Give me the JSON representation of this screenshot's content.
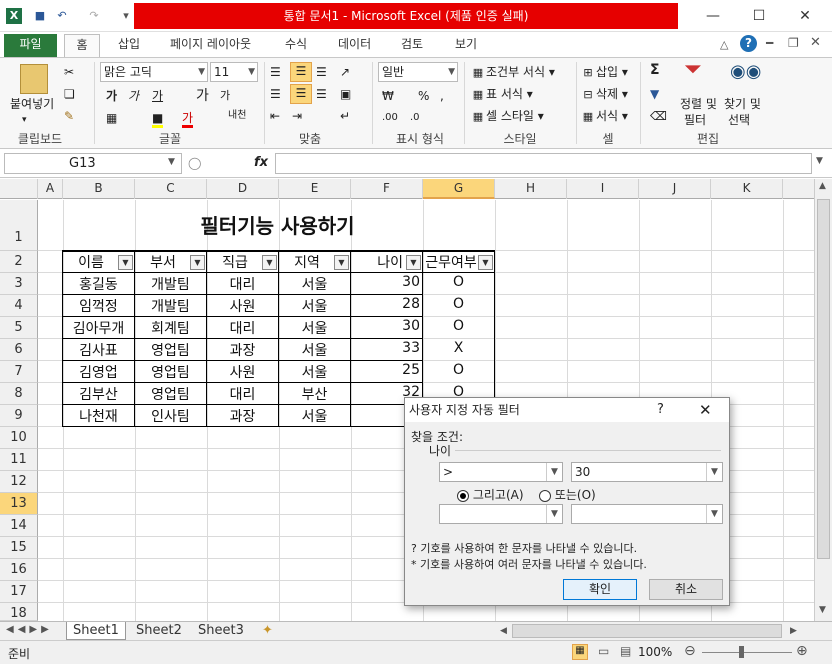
{
  "window": {
    "title": "통합 문서1 - Microsoft Excel (제품 인증 실패)"
  },
  "ribbon_tabs": [
    "파일",
    "홈",
    "삽입",
    "페이지 레이아웃",
    "수식",
    "데이터",
    "검토",
    "보기"
  ],
  "ribbon": {
    "paste_label": "붙여넣기",
    "font_name": "맑은 고딕",
    "font_size": "11",
    "number_format": "일반",
    "conditional_format": "조건부 서식",
    "table_format": "표 서식",
    "cell_style": "셀 스타일",
    "insert": "삽입",
    "delete": "삭제",
    "format": "서식",
    "sort_filter": "정렬 및",
    "sort_filter2": "필터",
    "find_select": "찾기 및",
    "find_select2": "선택",
    "groups": [
      "클립보드",
      "글꼴",
      "맞춤",
      "표시 형식",
      "스타일",
      "셀",
      "편집"
    ]
  },
  "formula_bar": {
    "name_box": "G13",
    "fx": "fx",
    "formula": ""
  },
  "columns": [
    "A",
    "B",
    "C",
    "D",
    "E",
    "F",
    "G",
    "H",
    "I",
    "J",
    "K"
  ],
  "rows": [
    "1",
    "2",
    "3",
    "4",
    "5",
    "6",
    "7",
    "8",
    "9",
    "10",
    "11",
    "12",
    "13",
    "14",
    "15",
    "16",
    "17",
    "18"
  ],
  "active_cell": "G13",
  "sheet": {
    "title": "필터기능 사용하기",
    "headers": [
      "이름",
      "부서",
      "직급",
      "지역",
      "나이",
      "근무여부"
    ],
    "data": [
      [
        "홍길동",
        "개발팀",
        "대리",
        "서울",
        "30",
        "O"
      ],
      [
        "임꺽정",
        "개발팀",
        "사원",
        "서울",
        "28",
        "O"
      ],
      [
        "김아무개",
        "회계팀",
        "대리",
        "서울",
        "30",
        "O"
      ],
      [
        "김사표",
        "영업팀",
        "과장",
        "서울",
        "33",
        "X"
      ],
      [
        "김영업",
        "영업팀",
        "사원",
        "서울",
        "25",
        "O"
      ],
      [
        "김부산",
        "영업팀",
        "대리",
        "부산",
        "32",
        "O"
      ],
      [
        "나천재",
        "인사팀",
        "과장",
        "서울",
        "",
        ""
      ]
    ]
  },
  "sheet_tabs": [
    "Sheet1",
    "Sheet2",
    "Sheet3"
  ],
  "status": {
    "mode": "준비",
    "zoom": "100%"
  },
  "dialog": {
    "title": "사용자 지정 자동 필터",
    "help": "?",
    "condition_label": "찾을 조건:",
    "field": "나이",
    "op1": ">",
    "val1": "30",
    "and_label": "그리고(A)",
    "or_label": "또는(O)",
    "op2": "",
    "val2": "",
    "hint1": "? 기호를 사용하여 한 문자를 나타낼 수 있습니다.",
    "hint2": "* 기호를 사용하여 여러 문자를 나타낼 수 있습니다.",
    "ok": "확인",
    "cancel": "취소"
  }
}
